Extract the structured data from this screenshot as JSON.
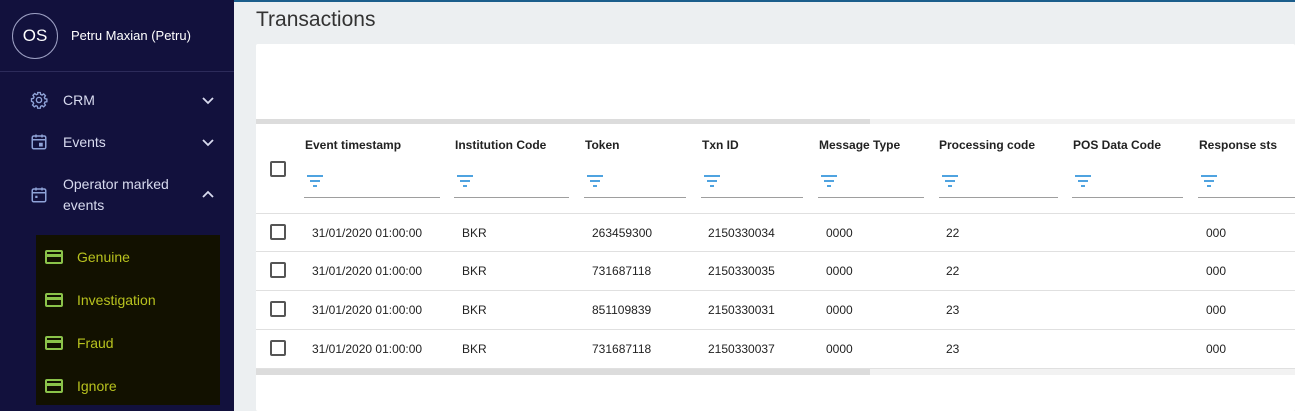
{
  "user": {
    "initials": "OS",
    "name": "Petru Maxian (Petru)"
  },
  "nav": {
    "crm": "CRM",
    "events": "Events",
    "operator_marked_line1": "Operator marked",
    "operator_marked_line2": "events",
    "submenu": [
      "Genuine",
      "Investigation",
      "Fraud",
      "Ignore"
    ]
  },
  "page_title": "Transactions",
  "table": {
    "columns": [
      "Event timestamp",
      "Institution Code",
      "Token",
      "Txn ID",
      "Message Type",
      "Processing code",
      "POS Data Code",
      "Response sts"
    ],
    "rows": [
      [
        "31/01/2020 01:00:00",
        "BKR",
        "263459300",
        "2150330034",
        "0000",
        "22",
        "",
        "000"
      ],
      [
        "31/01/2020 01:00:00",
        "BKR",
        "731687118",
        "2150330035",
        "0000",
        "22",
        "",
        "000"
      ],
      [
        "31/01/2020 01:00:00",
        "BKR",
        "851109839",
        "2150330031",
        "0000",
        "23",
        "",
        "000"
      ],
      [
        "31/01/2020 01:00:00",
        "BKR",
        "731687118",
        "2150330037",
        "0000",
        "23",
        "",
        "000"
      ]
    ]
  },
  "colors": {
    "sidebar": "#12113d",
    "submenu_bg": "#121100",
    "submenu_text": "#b8c21e",
    "filter_icon": "#4fa3e0"
  }
}
